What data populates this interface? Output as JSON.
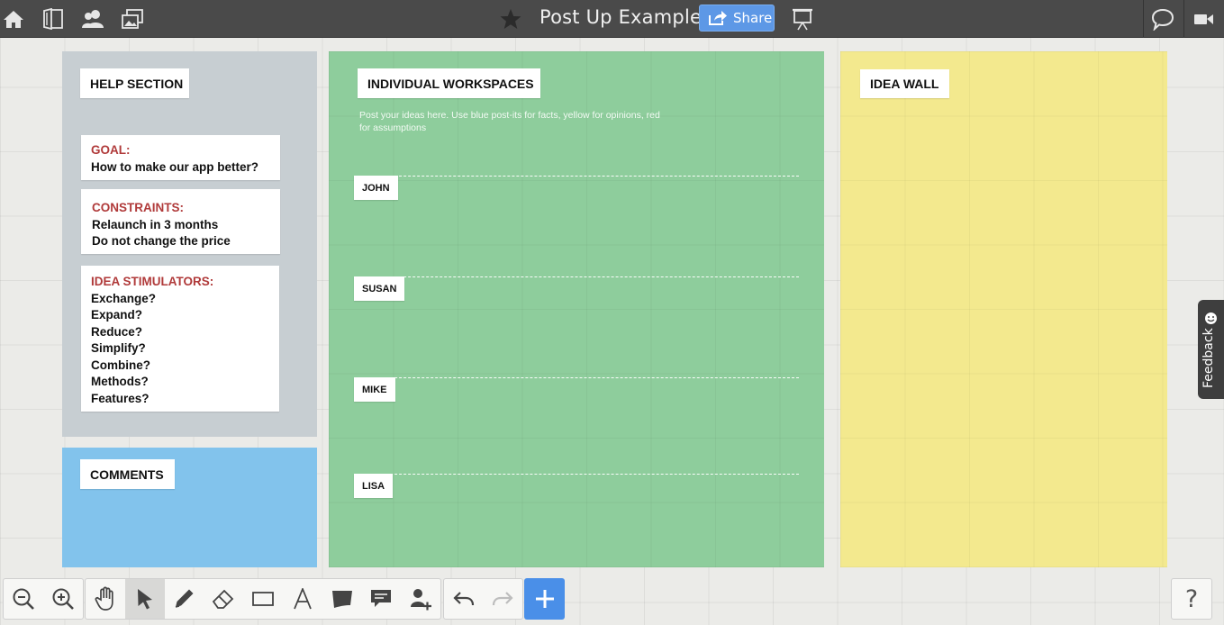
{
  "header": {
    "title": "Post Up Example",
    "share_label": "Share"
  },
  "help_section": {
    "title": "HELP SECTION",
    "goal": {
      "heading": "GOAL:",
      "lines": [
        "How to make our app better?"
      ]
    },
    "constraints": {
      "heading": "CONSTRAINTS:",
      "lines": [
        "Relaunch in 3 months",
        "Do not change the price"
      ]
    },
    "idea_stimulators": {
      "heading": "IDEA STIMULATORS:",
      "lines": [
        "Exchange?",
        "Expand?",
        "Reduce?",
        "Simplify?",
        "Combine?",
        "Methods?",
        "Features?"
      ]
    }
  },
  "comments": {
    "title": "COMMENTS"
  },
  "workspaces": {
    "title": "INDIVIDUAL WORKSPACES",
    "instructions": "Post your ideas here. Use blue post-its for facts, yellow for opinions, red for assumptions",
    "people": [
      "JOHN",
      "SUSAN",
      "MIKE",
      "LISA"
    ]
  },
  "idea_wall": {
    "title": "IDEA WALL"
  },
  "feedback_label": "Feedback",
  "help_button_label": "?",
  "colors": {
    "topbar": "#4a4a4a",
    "help_section": "#c7ced2",
    "comments": "#82c3ec",
    "workspaces": "#8ecd9c",
    "idea_wall": "#f3e98e",
    "accent_blue": "#4a8fe8",
    "heading_red": "#b03a3a"
  },
  "toolbar": {
    "icons": [
      "zoom-out-icon",
      "zoom-in-icon",
      "hand-icon",
      "pointer-icon",
      "pen-icon",
      "eraser-icon",
      "rectangle-icon",
      "text-icon",
      "sticky-note-icon",
      "comment-icon",
      "stamp-icon",
      "undo-icon",
      "redo-icon",
      "add-icon"
    ]
  }
}
